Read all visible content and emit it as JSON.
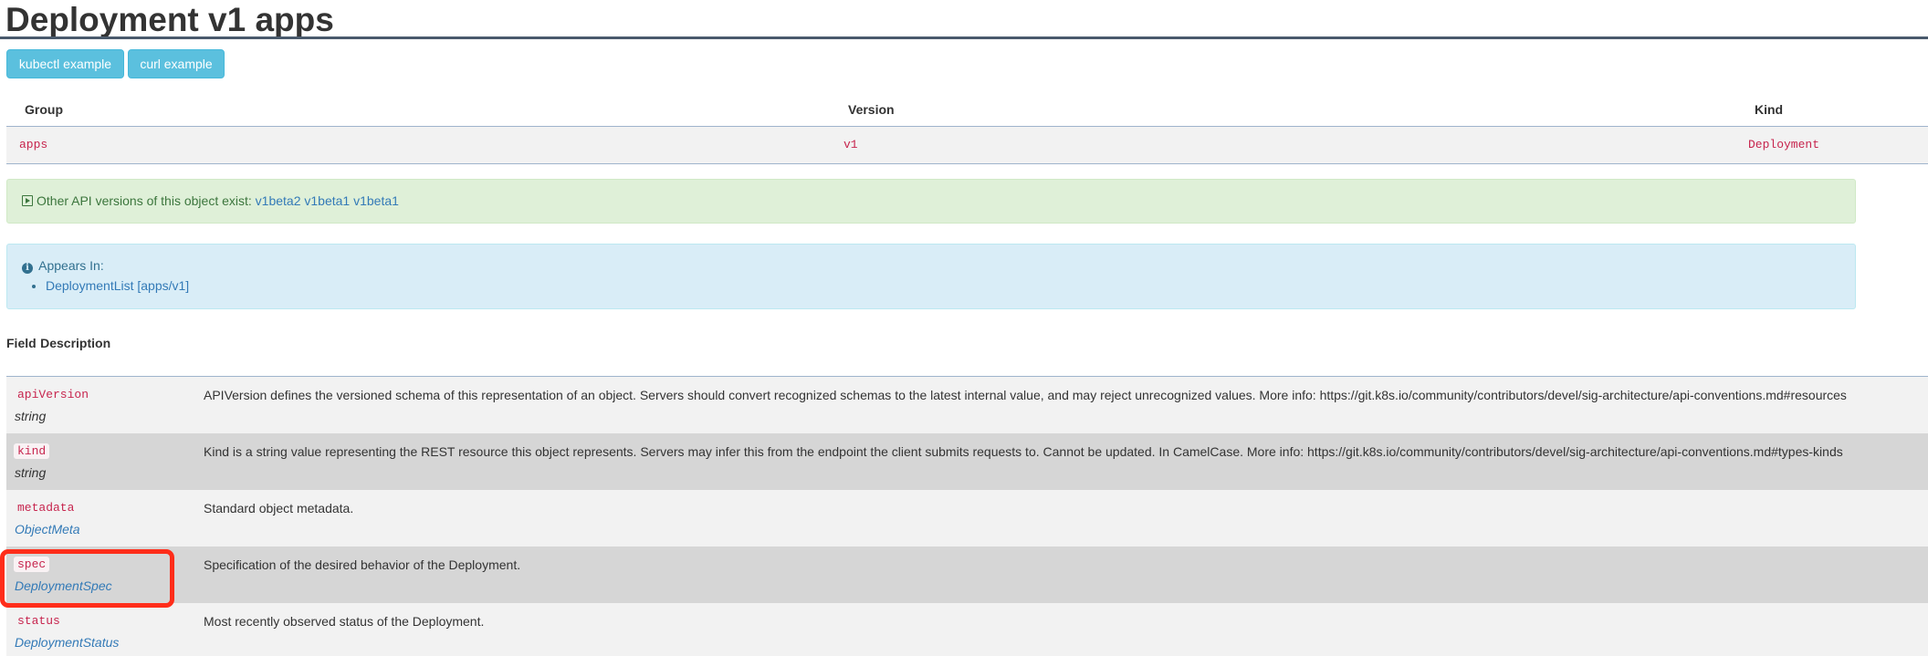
{
  "page": {
    "title": "Deployment v1 apps"
  },
  "buttons": {
    "kubectl": "kubectl example",
    "curl": "curl example"
  },
  "gvk_table": {
    "headers": [
      "Group",
      "Version",
      "Kind"
    ],
    "row": [
      "apps",
      "v1",
      "Deployment"
    ]
  },
  "other_versions": {
    "text": "Other API versions of this object exist:",
    "links": [
      "v1beta2",
      "v1beta1",
      "v1beta1"
    ]
  },
  "appears_in": {
    "label": "Appears In:",
    "items": [
      "DeploymentList [apps/v1]"
    ]
  },
  "fields_table": {
    "headers": [
      "Field",
      "Description"
    ],
    "rows": [
      {
        "name": "apiVersion",
        "type": "string",
        "type_is_link": false,
        "description": "APIVersion defines the versioned schema of this representation of an object. Servers should convert recognized schemas to the latest internal value, and may reject unrecognized values. More info: https://git.k8s.io/community/contributors/devel/sig-architecture/api-conventions.md#resources"
      },
      {
        "name": "kind",
        "type": "string",
        "type_is_link": false,
        "description": "Kind is a string value representing the REST resource this object represents. Servers may infer this from the endpoint the client submits requests to. Cannot be updated. In CamelCase. More info: https://git.k8s.io/community/contributors/devel/sig-architecture/api-conventions.md#types-kinds"
      },
      {
        "name": "metadata",
        "type": "ObjectMeta",
        "type_is_link": true,
        "description": "Standard object metadata."
      },
      {
        "name": "spec",
        "type": "DeploymentSpec",
        "type_is_link": true,
        "description": "Specification of the desired behavior of the Deployment."
      },
      {
        "name": "status",
        "type": "DeploymentStatus",
        "type_is_link": true,
        "description": "Most recently observed status of the Deployment."
      }
    ]
  },
  "icons": {
    "expand": "play-square-icon",
    "info": "info-circle-icon"
  },
  "colors": {
    "accent_button": "#5bc0de",
    "code_text": "#c7254e",
    "link": "#337ab7",
    "highlight": "#ff2d1a"
  }
}
